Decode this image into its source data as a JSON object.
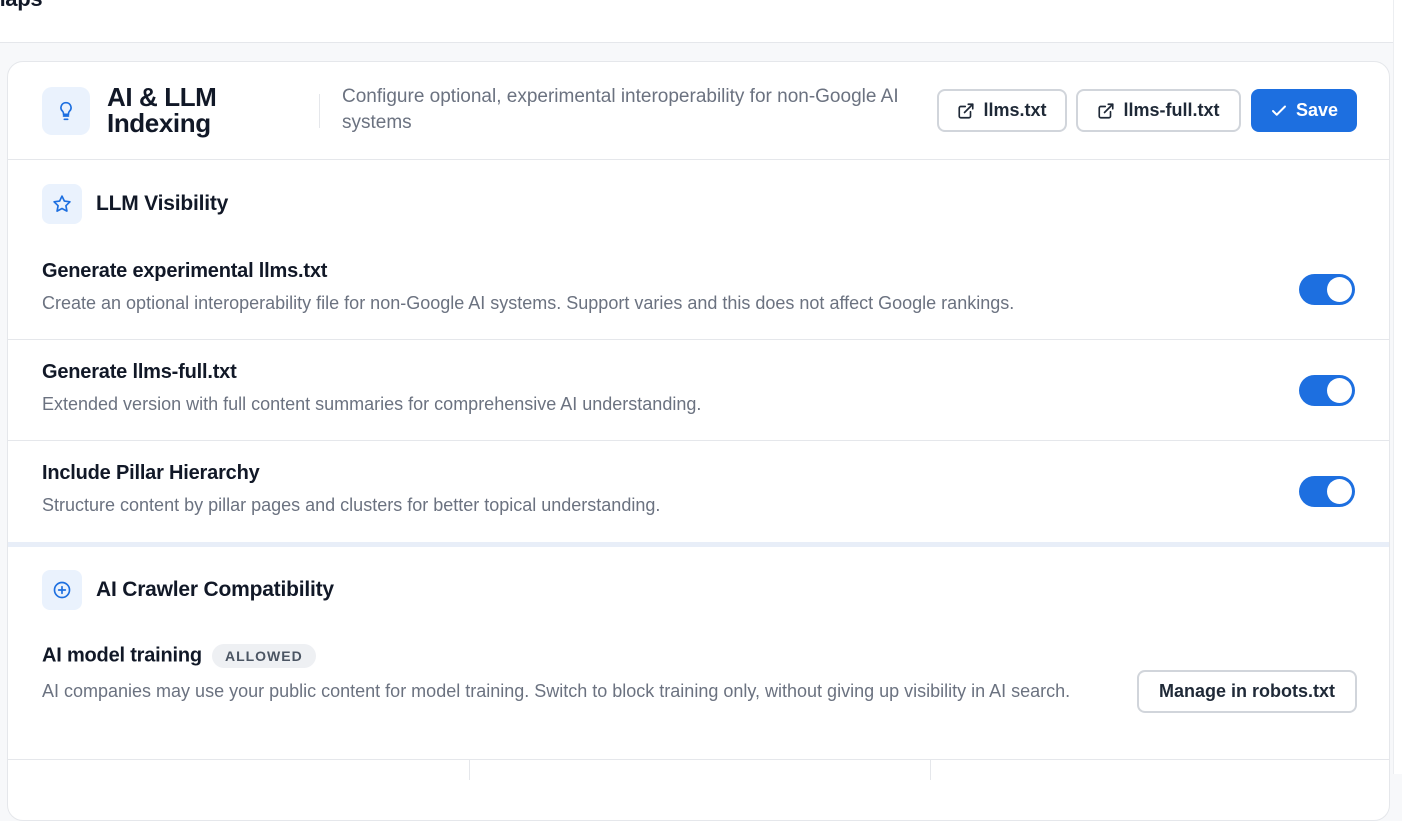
{
  "topbar": {
    "title": "maps"
  },
  "header": {
    "icon": "lightbulb-icon",
    "title": "AI & LLM Indexing",
    "description": "Configure optional, experimental interoperability for non-Google AI systems",
    "buttons": {
      "llms_label": "llms.txt",
      "llms_full_label": "llms-full.txt",
      "save_label": "Save"
    }
  },
  "llm_visibility": {
    "icon": "star-icon",
    "title": "LLM Visibility",
    "rows": [
      {
        "title": "Generate experimental llms.txt",
        "description": "Create an optional interoperability file for non-Google AI systems. Support varies and this does not affect Google rankings.",
        "enabled": true
      },
      {
        "title": "Generate llms-full.txt",
        "description": "Extended version with full content summaries for comprehensive AI understanding.",
        "enabled": true
      },
      {
        "title": "Include Pillar Hierarchy",
        "description": "Structure content by pillar pages and clusters for better topical understanding.",
        "enabled": true
      }
    ]
  },
  "crawler": {
    "icon": "plus-circle-icon",
    "title": "AI Crawler Compatibility",
    "training": {
      "title": "AI model training",
      "badge": "ALLOWED",
      "description": "AI companies may use your public content for model training. Switch to block training only, without giving up visibility in AI search.",
      "button_label": "Manage in robots.txt"
    }
  },
  "colors": {
    "accent": "#1d6fe0",
    "icon_bg": "#eaf2fd"
  }
}
